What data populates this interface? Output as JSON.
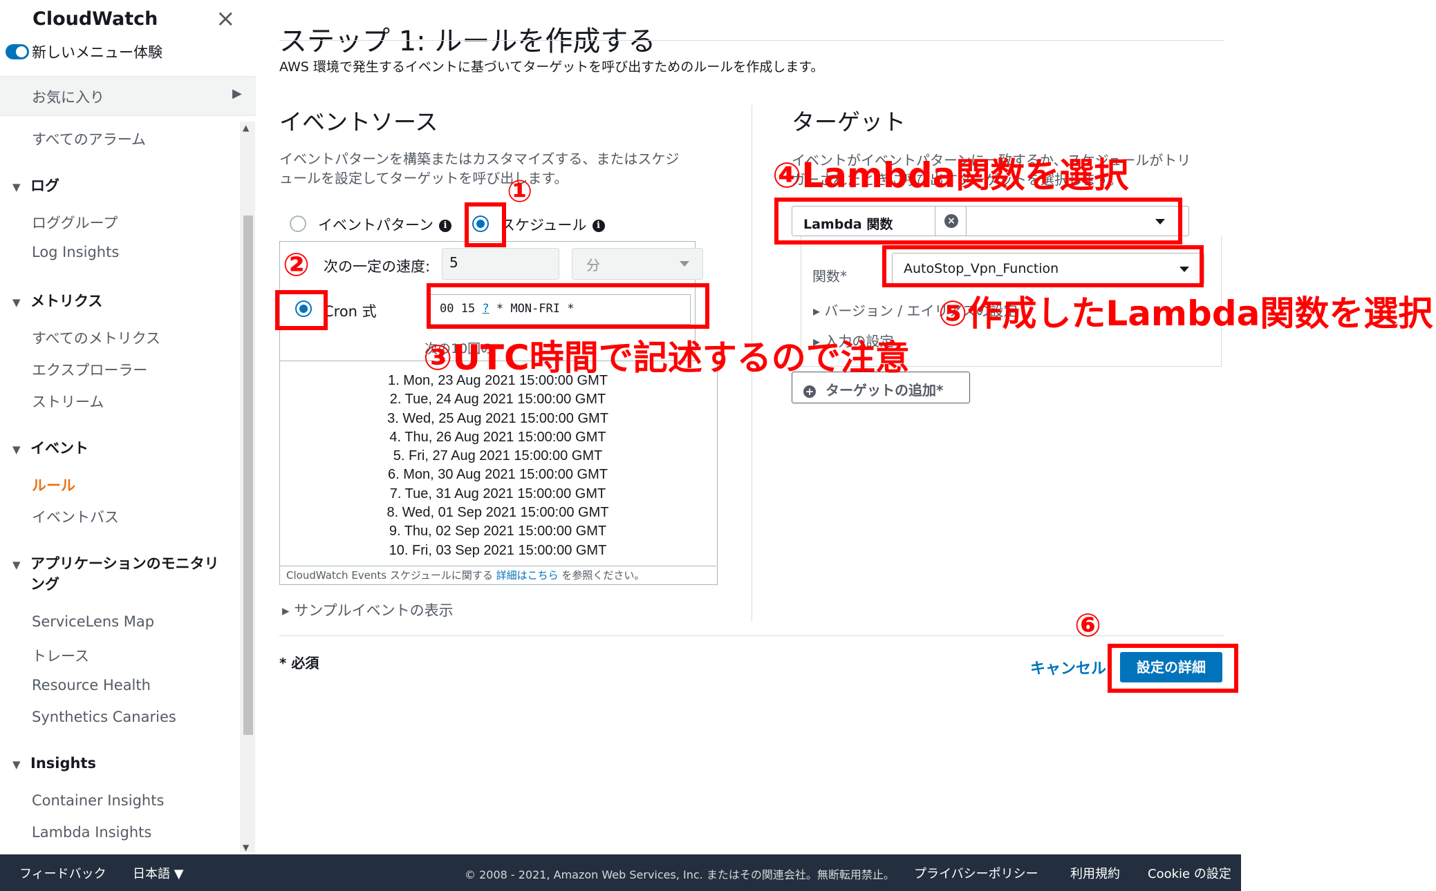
{
  "sidebar": {
    "title": "CloudWatch",
    "close_icon": "×",
    "toggle_label": "新しいメニュー体験",
    "favorites": "お気に入り",
    "favorites_arrow": "▶",
    "all_alarms": "すべてのアラーム",
    "logs": {
      "head": "ログ",
      "items": [
        "ロググループ",
        "Log Insights"
      ]
    },
    "metrics": {
      "head": "メトリクス",
      "items": [
        "すべてのメトリクス",
        "エクスプローラー",
        "ストリーム"
      ]
    },
    "events": {
      "head": "イベント",
      "items": [
        "ルール",
        "イベントバス"
      ]
    },
    "appmon": {
      "head1": "アプリケーションのモニタリ",
      "head2": "ング",
      "items": [
        "ServiceLens Map",
        "トレース",
        "Resource Health",
        "Synthetics Canaries"
      ]
    },
    "insights": {
      "head": "Insights",
      "items": [
        "Container Insights",
        "Lambda Insights"
      ]
    },
    "tri_icon": "▼"
  },
  "main": {
    "title": "ステップ 1: ルールを作成する",
    "description": "AWS 環境で発生するイベントに基づいてターゲットを呼び出すためのルールを作成します。",
    "event_source": {
      "title": "イベントソース",
      "desc1": "イベントパターンを構築またはカスタマイズする、またはスケジ",
      "desc2": "ュールを設定してターゲットを呼び出します。",
      "opt_pattern": "イベントパターン",
      "opt_schedule": "スケジュール",
      "info_icon": "i",
      "rate_label": "次の一定の速度:",
      "rate_value": "5",
      "rate_unit": "分",
      "cron_label": "Cron 式",
      "cron_value_a": "00 15 ",
      "cron_value_b": "?",
      "cron_value_c": " * MON-FRI *",
      "next_label": "次の10回の",
      "next_runs": [
        "1. Mon, 23 Aug 2021 15:00:00 GMT",
        "2. Tue, 24 Aug 2021 15:00:00 GMT",
        "3. Wed, 25 Aug 2021 15:00:00 GMT",
        "4. Thu, 26 Aug 2021 15:00:00 GMT",
        "5. Fri, 27 Aug 2021 15:00:00 GMT",
        "6. Mon, 30 Aug 2021 15:00:00 GMT",
        "7. Tue, 31 Aug 2021 15:00:00 GMT",
        "8. Wed, 01 Sep 2021 15:00:00 GMT",
        "9. Thu, 02 Sep 2021 15:00:00 GMT",
        "10. Fri, 03 Sep 2021 15:00:00 GMT"
      ],
      "note_pre": "CloudWatch Events スケジュールに関する",
      "note_link": "詳細はこちら",
      "note_post": "を参照ください。",
      "sample_toggle": "サンプルイベントの表示"
    },
    "target": {
      "title": "ターゲット",
      "desc1": "イベントがイベントパターンに一致するか、スケジュールがトリ",
      "desc2": "ガーされたときに呼び出すターゲットを選択します。",
      "type_value": "Lambda 関数",
      "remove_icon": "×",
      "function_label": "関数*",
      "function_value": "AutoStop_Vpn_Function",
      "version_alias": "バージョン / エイリアスの設定",
      "input_config": "入力の設定",
      "add_target": "ターゲットの追加*",
      "plus_icon": "+"
    },
    "required_note": "* 必須",
    "cancel": "キャンセル",
    "detail": "設定の詳細"
  },
  "footer": {
    "feedback": "フィードバック",
    "language": "日本語 ▼",
    "copyright": "© 2008 - 2021, Amazon Web Services, Inc. またはその関連会社。無断転用禁止。",
    "privacy": "プライバシーポリシー",
    "terms": "利用規約",
    "cookie": "Cookie の設定"
  },
  "annotations": {
    "n1": "①",
    "n2": "②",
    "n3": "③UTC時間で記述するので注意",
    "n4": "④Lambda関数を選択",
    "n5": "⑤作成したLambda関数を選択",
    "n6": "⑥",
    "color": "#ff0000"
  }
}
